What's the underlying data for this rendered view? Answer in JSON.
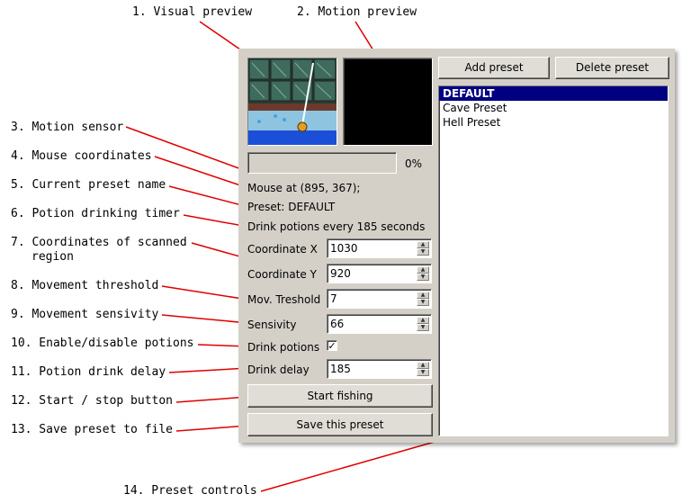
{
  "annotations": [
    "1. Visual preview",
    "2. Motion preview",
    "3. Motion sensor",
    "4. Mouse coordinates",
    "5. Current preset name",
    "6. Potion drinking timer",
    "7. Coordinates of scanned",
    "region",
    "8. Movement threshold",
    "9. Movement sensivity",
    "10. Enable/disable potions",
    "11. Potion drink delay",
    "12. Start / stop button",
    "13. Save preset to file",
    "14. Preset controls"
  ],
  "progress": {
    "value_percent": 0,
    "label": "0%"
  },
  "status": {
    "mouse": "Mouse at (895, 367);",
    "preset": "Preset: DEFAULT",
    "potions": "Drink potions every 185 seconds"
  },
  "fields": {
    "coord_x": {
      "label": "Coordinate X",
      "value": "1030"
    },
    "coord_y": {
      "label": "Coordinate Y",
      "value": "920"
    },
    "threshold": {
      "label": "Mov. Treshold",
      "value": "7"
    },
    "sensivity": {
      "label": "Sensivity",
      "value": "66"
    },
    "drink_potions": {
      "label": "Drink potions",
      "checked": true,
      "mark": "✓"
    },
    "drink_delay": {
      "label": "Drink delay",
      "value": "185"
    }
  },
  "buttons": {
    "start": "Start fishing",
    "save": "Save this preset",
    "add": "Add preset",
    "delete": "Delete preset"
  },
  "presets": [
    "DEFAULT",
    "Cave Preset",
    "Hell Preset"
  ],
  "selected_preset": "DEFAULT",
  "colors": {
    "annotation_line": "#e00000",
    "selection": "#000080",
    "window": "#d4d0c8"
  }
}
